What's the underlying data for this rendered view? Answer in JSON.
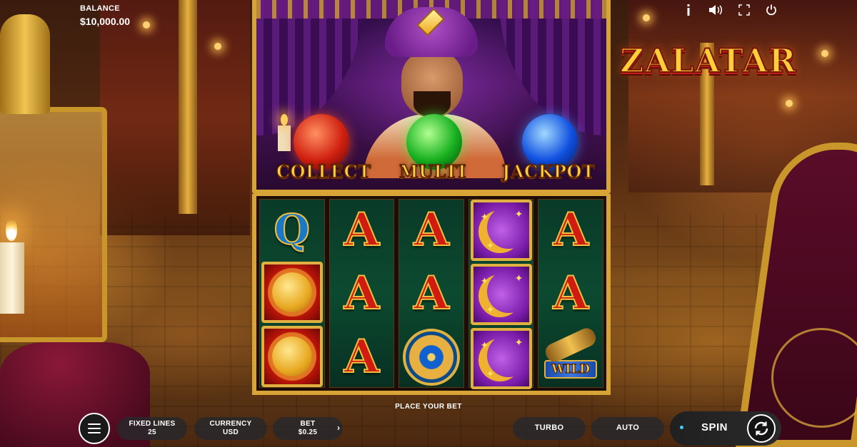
{
  "header": {
    "balance_label": "BALANCE",
    "balance_value": "$10,000.00"
  },
  "top_icons": [
    "info-icon",
    "sound-icon",
    "fullscreen-icon",
    "power-icon"
  ],
  "game": {
    "title": "ZALATAR",
    "features": [
      "COLLECT",
      "MULTI",
      "JACKPOT"
    ],
    "reels": [
      [
        "Q",
        "sun",
        "sun"
      ],
      [
        "A",
        "A",
        "A"
      ],
      [
        "A",
        "A",
        "wheel"
      ],
      [
        "moon",
        "moon",
        "moon"
      ],
      [
        "A",
        "A",
        "wild"
      ]
    ],
    "wild_label": "WILD",
    "status_message": "PLACE YOUR BET"
  },
  "controls": {
    "fixed_lines_label": "FIXED LINES",
    "fixed_lines_value": "25",
    "currency_label": "CURRENCY",
    "currency_value": "USD",
    "bet_label": "BET",
    "bet_value": "$0.25",
    "bet_arrow": "›",
    "turbo_label": "TURBO",
    "auto_label": "AUTO",
    "spin_label": "SPIN"
  },
  "colors": {
    "gold_frame": "#d8a436",
    "reel_bg": "#0c4a30",
    "symbol_red": "#d01c10",
    "logo_gold": "#ffcf3a",
    "bar_bg": "#28282c"
  }
}
